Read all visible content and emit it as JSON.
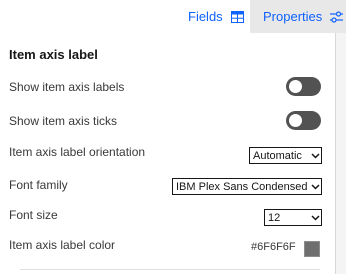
{
  "tabs": {
    "fields": {
      "label": "Fields",
      "icon": "table-icon"
    },
    "properties": {
      "label": "Properties",
      "icon": "sliders-icon",
      "active": true
    }
  },
  "section": {
    "title": "Item axis label",
    "rows": {
      "show_labels": {
        "label": "Show item axis labels",
        "toggle_on": false
      },
      "show_ticks": {
        "label": "Show item axis ticks",
        "toggle_on": false
      },
      "orientation": {
        "label": "Item axis label orientation",
        "value": "Automatic"
      },
      "font_family": {
        "label": "Font family",
        "value": "IBM Plex Sans Condensed"
      },
      "font_size": {
        "label": "Font size",
        "value": "12"
      },
      "color": {
        "label": "Item axis label color",
        "value": "#6F6F6F",
        "swatch": "#6F6F6F"
      }
    }
  },
  "colors": {
    "accent": "#0f62fe",
    "toggle_off": "#525252",
    "background": "#f4f4f4"
  }
}
